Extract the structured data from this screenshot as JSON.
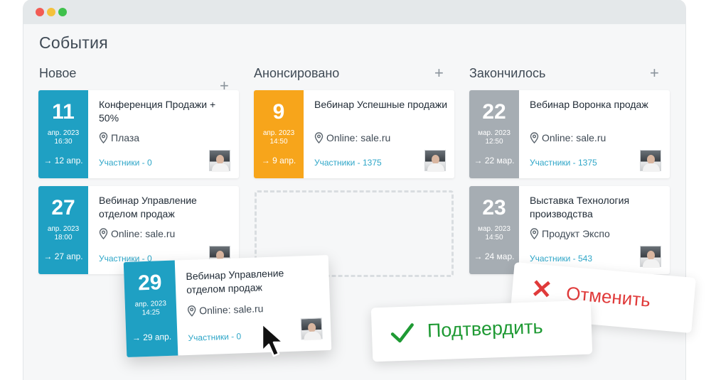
{
  "page_title": "События",
  "columns": [
    {
      "title": "Новое",
      "plus": "+"
    },
    {
      "title": "Анонсировано",
      "plus": "+"
    },
    {
      "title": "Закончилось",
      "plus": "+"
    }
  ],
  "cards": [
    {
      "day": "11",
      "month": "апр. 2023",
      "time": "16:30",
      "until": "→ 12 апр.",
      "title": "Конференция Продажи + 50%",
      "location": "Плаза",
      "participants": "Участники - 0",
      "color": "#1fa0c3"
    },
    {
      "day": "27",
      "month": "апр. 2023",
      "time": "18:00",
      "until": "→ 27 апр.",
      "title": "Вебинар Управление отделом продаж",
      "location": "Online: sale.ru",
      "participants": "Участники - 0",
      "color": "#1fa0c3"
    },
    {
      "day": "9",
      "month": "апр. 2023",
      "time": "14:50",
      "until": "→ 9 апр.",
      "title": "Вебинар Успешные продажи",
      "location": "Online: sale.ru",
      "participants": "Участники - 1375",
      "color": "#f7a51b"
    },
    {
      "day": "22",
      "month": "мар. 2023",
      "time": "12:50",
      "until": "→ 22 мар.",
      "title": "Вебинар Воронка продаж",
      "location": "Online: sale.ru",
      "participants": "Участники - 1375",
      "color": "#a6adb3"
    },
    {
      "day": "23",
      "month": "мар. 2023",
      "time": "14:50",
      "until": "→ 24 мар.",
      "title": "Выставка Технология производства",
      "location": "Продукт Экспо",
      "participants": "Участники - 543",
      "color": "#a6adb3"
    }
  ],
  "dragged_card": {
    "day": "29",
    "month": "апр. 2023",
    "time": "14:25",
    "until": "→ 29 апр.",
    "title": "Вебинар Управление отделом продаж",
    "location": "Online: sale.ru",
    "participants": "Участники - 0",
    "color": "#1fa0c3"
  },
  "actions": {
    "confirm": "Подтвердить",
    "cancel": "Отменить"
  },
  "colors": {
    "new": "#1fa0c3",
    "announced": "#f7a51b",
    "finished": "#a6adb3",
    "confirm": "#1f9a34",
    "cancel": "#e03a3a"
  }
}
